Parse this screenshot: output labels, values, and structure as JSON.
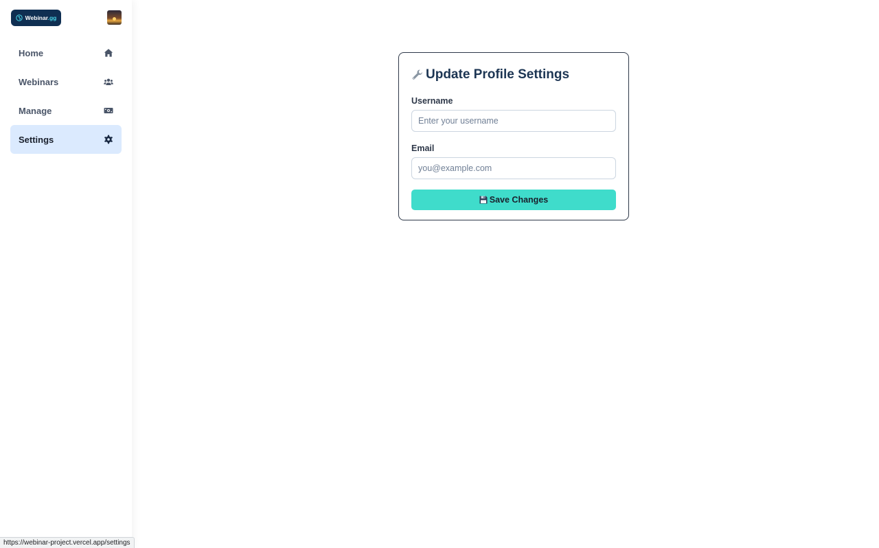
{
  "brand": {
    "logo_name": "Webinar",
    "logo_tld": ".gg",
    "logo_icon": "globe-icon",
    "avatar": "profile-avatar"
  },
  "sidebar": {
    "items": [
      {
        "label": "Home",
        "icon": "home-icon",
        "active": false
      },
      {
        "label": "Webinars",
        "icon": "users-icon",
        "active": false
      },
      {
        "label": "Manage",
        "icon": "money-icon",
        "active": false
      },
      {
        "label": "Settings",
        "icon": "gear-icon",
        "active": true
      }
    ]
  },
  "settings_card": {
    "title_icon": "wrench-icon",
    "title": "Update Profile Settings",
    "username_label": "Username",
    "username_placeholder": "Enter your username",
    "username_value": "",
    "email_label": "Email",
    "email_placeholder": "you@example.com",
    "email_value": "",
    "save_icon": "floppy-icon",
    "save_label": "Save Changes"
  },
  "status_bar": {
    "url": "https://webinar-project.vercel.app/settings"
  },
  "colors": {
    "accent": "#3fdccb",
    "active_nav_bg": "#dbeafe",
    "logo_bg": "#0f2f52",
    "title": "#1c3553"
  }
}
